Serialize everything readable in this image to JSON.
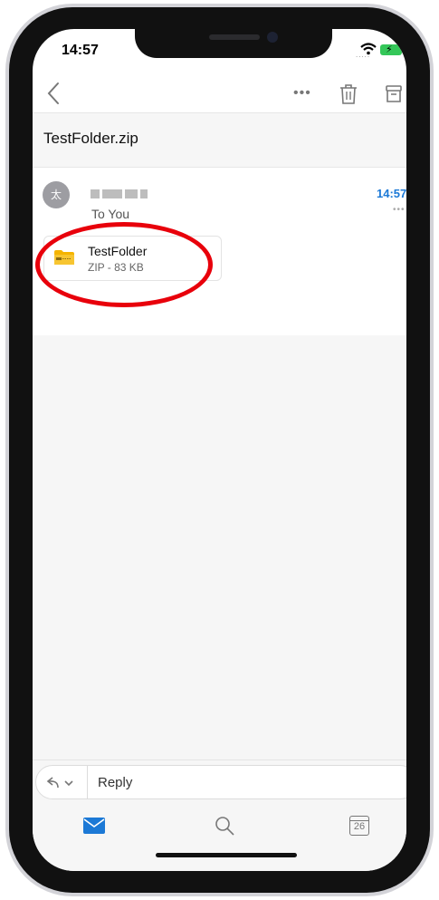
{
  "status_bar": {
    "time": "14:57",
    "signal": "....."
  },
  "subject": "TestFolder.zip",
  "message": {
    "avatar_initial": "太",
    "recipient": "To You",
    "time": "14:57",
    "more": "•••"
  },
  "toolbar": {
    "more": "•••"
  },
  "attachment": {
    "name": "TestFolder",
    "meta": "ZIP - 83 KB"
  },
  "reply": {
    "label": "Reply"
  },
  "tab_bar": {
    "calendar_day": "26"
  },
  "colors": {
    "accent": "#1c79d6",
    "highlight": "#e8000b",
    "battery": "#34c759",
    "zip_icon": "#f5b400"
  }
}
